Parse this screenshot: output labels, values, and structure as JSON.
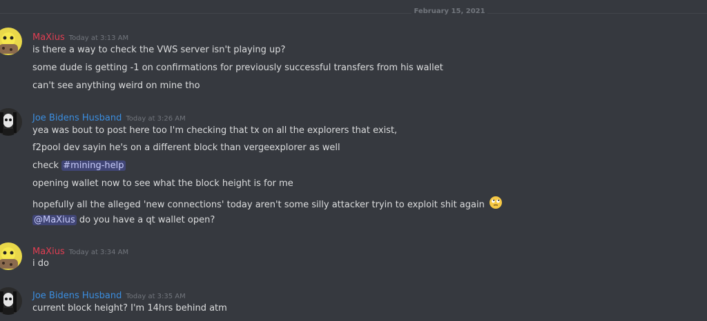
{
  "divider": {
    "date": "February 15, 2021"
  },
  "messages": [
    {
      "username": "MaXius",
      "timestamp": "Today at 3:13 AM",
      "lines": [
        "is there a way to check the VWS server isn't playing up?",
        "some dude is getting -1 on confirmations for previously successful transfers from his wallet",
        "can't see anything weird on mine tho"
      ]
    },
    {
      "username": "Joe Bidens Husband",
      "timestamp": "Today at 3:26 AM",
      "lines": [
        "yea was bout to post here too I'm checking that tx on all the explorers that exist,",
        "f2pool dev sayin he's on a different block than vergeexplorer as well",
        "check",
        "opening wallet now to see what the block height is for me",
        "hopefully all the alleged 'new connections'  today aren't some silly attacker tryin to exploit shit again",
        "do you have a qt wallet open?"
      ],
      "channel_mention": "#mining-help",
      "user_mention": "@MaXius"
    },
    {
      "username": "MaXius",
      "timestamp": "Today at 3:34 AM",
      "lines": [
        "i do"
      ]
    },
    {
      "username": "Joe Bidens Husband",
      "timestamp": "Today at 3:35 AM",
      "lines": [
        "current block height?  I'm 14hrs behind atm"
      ]
    }
  ],
  "icons": {
    "eyeroll": "face-with-rolling-eyes-icon"
  }
}
